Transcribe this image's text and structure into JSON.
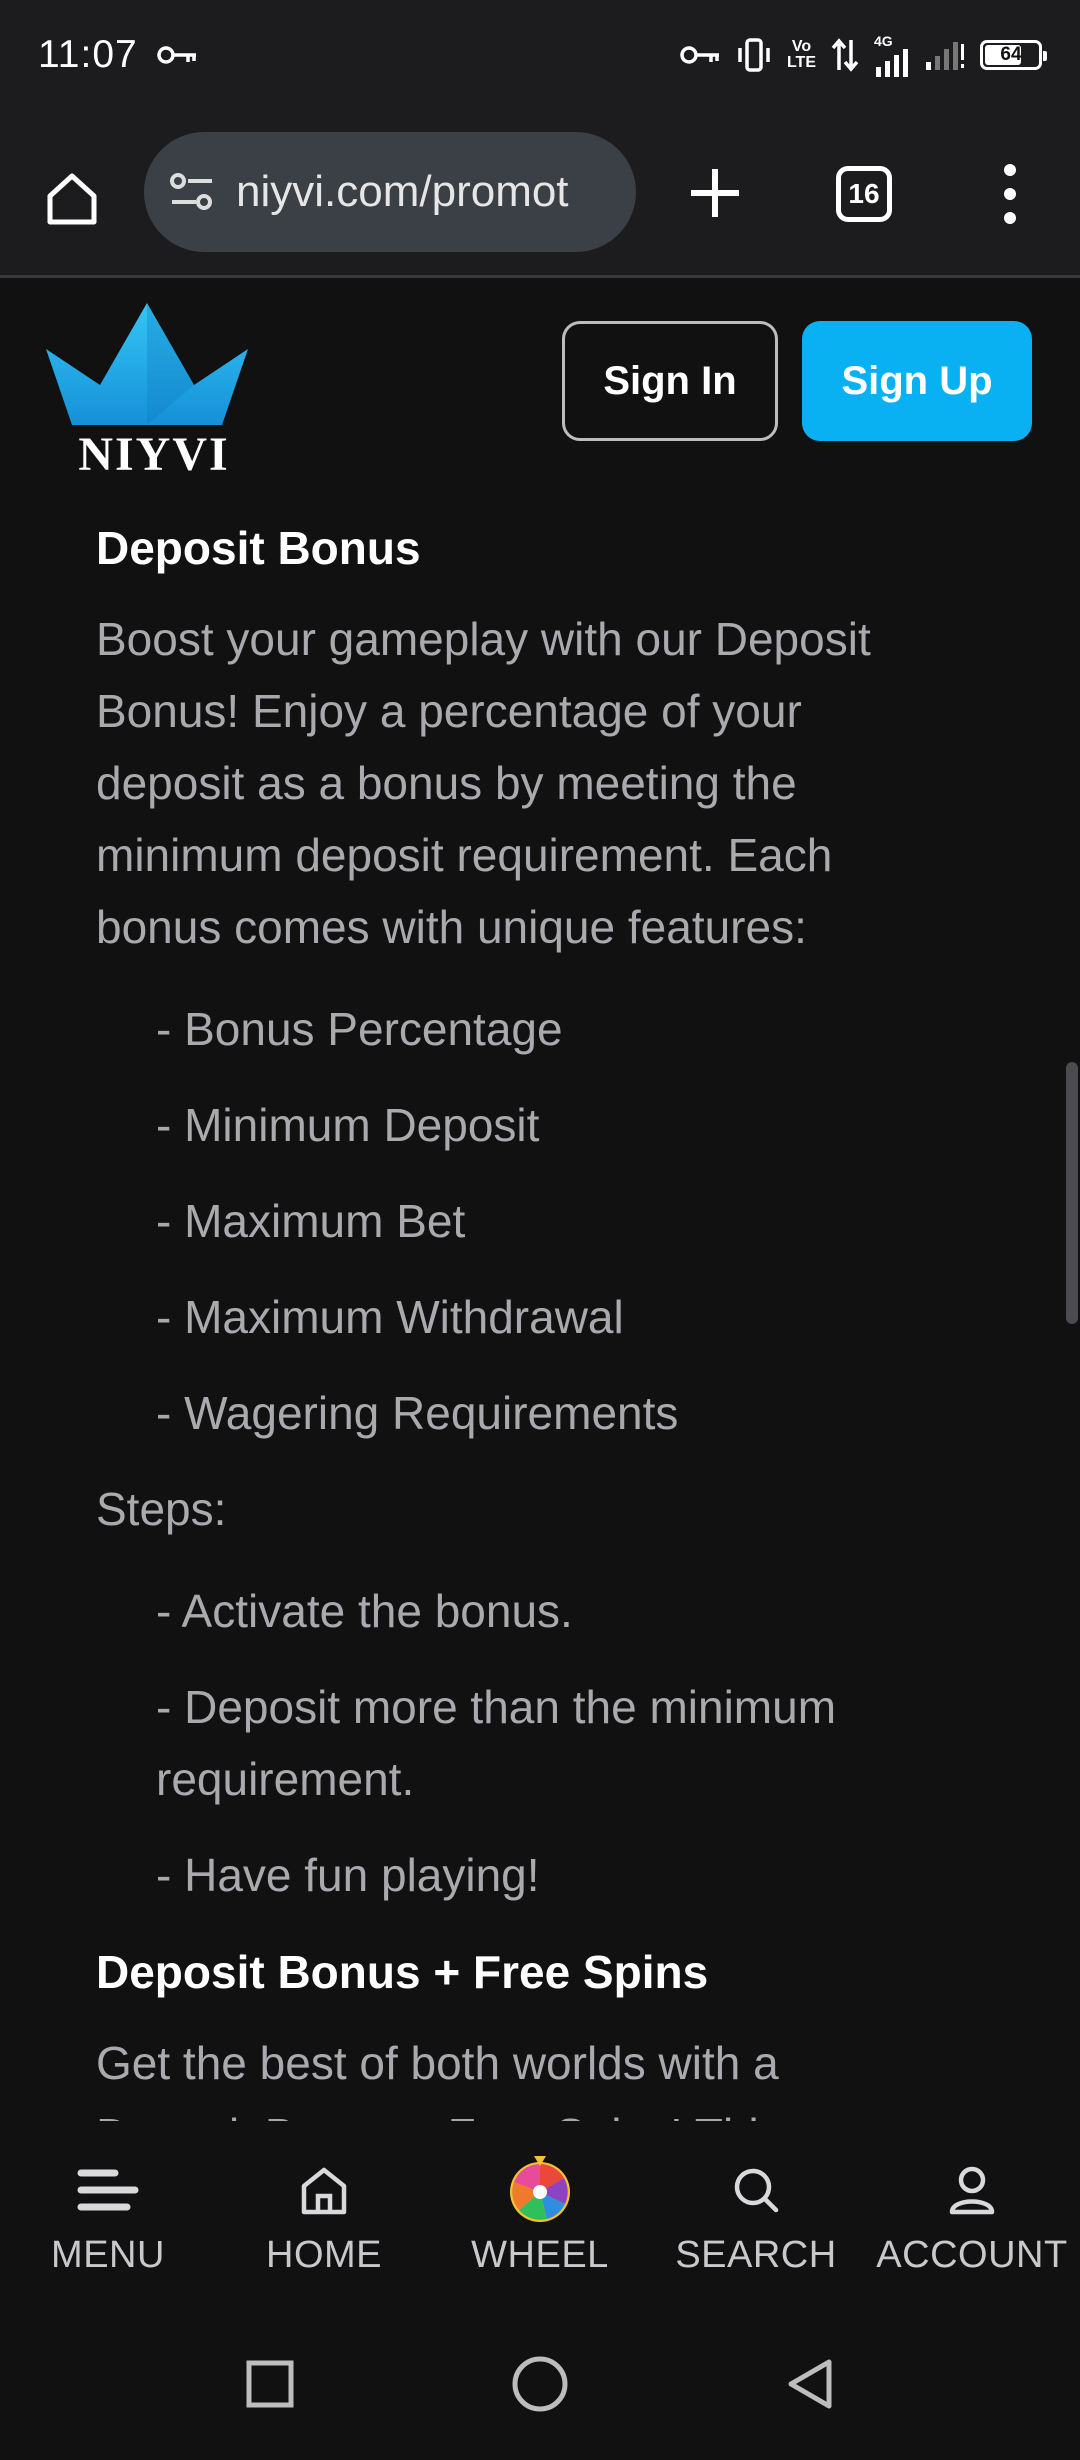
{
  "status_bar": {
    "time": "11:07",
    "battery": "64",
    "network_label_volte_top": "Vo",
    "network_label_volte_bottom": "LTE",
    "network_label_4g": "4G",
    "icons": [
      "key-icon",
      "vibrate-icon",
      "volte-icon",
      "data-arrows-icon",
      "signal-icon",
      "signal-weak-icon",
      "battery-icon"
    ]
  },
  "browser": {
    "url": "niyvi.com/promot",
    "tab_count": "16",
    "icons": [
      "home-icon",
      "site-settings-icon",
      "new-tab-icon",
      "tabs-icon",
      "more-menu-icon"
    ]
  },
  "header": {
    "logo_text": "NIYVI",
    "signin_label": "Sign In",
    "signup_label": "Sign Up",
    "accent_color": "#0ab1f2"
  },
  "content": {
    "section1": {
      "title": "Deposit Bonus",
      "intro_lines": [
        "Boost your gameplay with our Deposit",
        "Bonus! Enjoy a percentage of your",
        "deposit as a bonus by meeting the",
        "minimum deposit requirement. Each",
        "bonus comes with unique features:"
      ],
      "features": [
        "- Bonus Percentage",
        "- Minimum Deposit",
        "- Maximum Bet",
        "- Maximum Withdrawal",
        "- Wagering Requirements"
      ],
      "steps_label": "Steps:",
      "steps": [
        "- Activate the bonus.",
        "- Deposit more than the minimum",
        "requirement.",
        "- Have fun playing!"
      ]
    },
    "section2": {
      "title": "Deposit Bonus + Free Spins",
      "intro_line": "Get the best of both worlds with a",
      "intro_line_cut": "Deposit Bonus + Free Spins! This"
    }
  },
  "bottom_nav": {
    "items": [
      {
        "label": "MENU",
        "icon": "menu-icon"
      },
      {
        "label": "HOME",
        "icon": "home-icon"
      },
      {
        "label": "WHEEL",
        "icon": "wheel-icon"
      },
      {
        "label": "SEARCH",
        "icon": "search-icon"
      },
      {
        "label": "ACCOUNT",
        "icon": "account-icon"
      }
    ]
  },
  "system_nav": {
    "icons": [
      "recents-icon",
      "home-circle-icon",
      "back-icon"
    ]
  }
}
